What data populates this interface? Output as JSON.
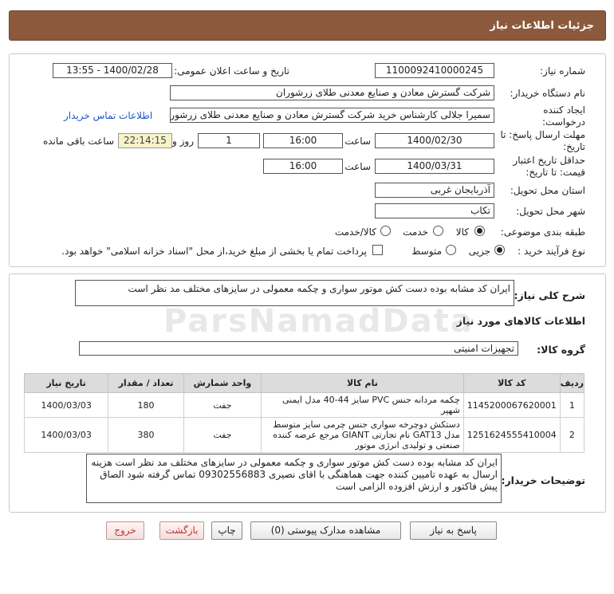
{
  "header": {
    "title": "جزئیات اطلاعات نیاز"
  },
  "form": {
    "need_number_label": "شماره نیاز:",
    "need_number": "1100092410000245",
    "announce_label": "تاریخ و ساعت اعلان عمومی:",
    "announce_value": "1400/02/28 - 13:55",
    "buyer_org_label": "نام دستگاه خریدار:",
    "buyer_org": "شرکت گسترش معادن و صنایع معدنی طلای زرشوران",
    "creator_label": "ایجاد کننده درخواست:",
    "creator": "سمیرا جلالی کارشناس خرید شرکت گسترش معادن و صنایع معدنی طلای زرشوران",
    "contact_link": "اطلاعات تماس خریدار",
    "reply_deadline_label": "مهلت ارسال پاسخ: تا تاریخ:",
    "reply_date": "1400/02/30",
    "time_label": "ساعت",
    "reply_time": "16:00",
    "days": "1",
    "days_label": "روز و",
    "remaining_time": "22:14:15",
    "remaining_label": "ساعت باقی مانده",
    "validity_label": "حداقل تاریخ اعتبار قیمت: تا تاریخ:",
    "validity_date": "1400/03/31",
    "validity_time": "16:00",
    "province_label": "استان محل تحویل:",
    "province": "آذربایجان غربی",
    "city_label": "شهر محل تحویل:",
    "city": "تکاب",
    "category_label": "طبقه بندی موضوعی:",
    "category_options": [
      "کالا",
      "خدمت",
      "کالا/خدمت"
    ],
    "process_label": "نوع فرآیند خرید :",
    "process_options": [
      "جزیی",
      "متوسط"
    ],
    "payment_note": "پرداخت تمام یا بخشی از مبلغ خرید،از محل \"اسناد خزانه اسلامی\" خواهد بود."
  },
  "summary": {
    "label": "شرح کلی نیاز:",
    "text": "ایران کد مشابه بوده دست کش موتور سواری و چکمه معمولی در سایزهای مختلف مد نظر است",
    "goods_info_title": "اطلاعات کالاهای مورد نیاز",
    "group_label": "گروه کالا:",
    "group_value": "تجهیزات امنیتی"
  },
  "table": {
    "headers": [
      "ردیف",
      "کد کالا",
      "نام کالا",
      "واحد شمارش",
      "تعداد / مقدار",
      "تاریخ نیاز"
    ],
    "rows": [
      [
        "1",
        "1145200067620001",
        "چکمه مردانه جنس PVC سایز 44-40 مدل ایمنی شهپر",
        "جفت",
        "180",
        "1400/03/03"
      ],
      [
        "2",
        "1251624555410004",
        "دستکش دوچرخه سواری جنس چرمی سایز متوسط مدل GAT13 نام تجارتی GIANT مرجع عرضه کننده صنعتی و تولیدی انرژی موتور",
        "جفت",
        "380",
        "1400/03/03"
      ]
    ]
  },
  "buyer_notes": {
    "label": "توضیحات خریدار:",
    "text": "ایران کد مشابه بوده دست کش موتور سواری و چکمه معمولی در سایزهای مختلف مد نظر است هزینه ارسال به عهده تامیین کننده جهت هماهنگی با اقای نصیری 09302556883 تماس گرفته شود الصاق پیش فاکتور و ارزش افزوده الزامی است"
  },
  "buttons": {
    "reply": "پاسخ به نیاز",
    "attachments": "مشاهده مدارک پیوستی (0)",
    "print": "چاپ",
    "back": "بازگشت",
    "exit": "خروج"
  },
  "watermark": {
    "brand": "ParsNamadData"
  }
}
